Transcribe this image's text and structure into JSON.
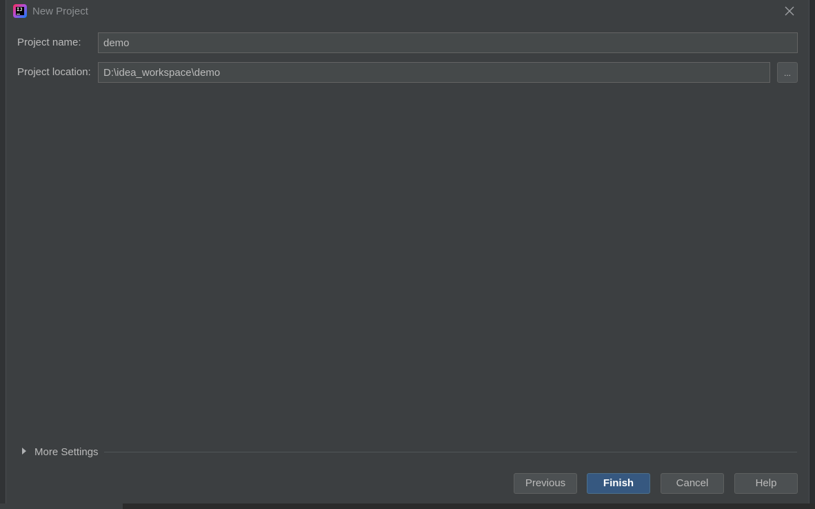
{
  "window": {
    "title": "New Project",
    "app_icon": "intellij-idea-icon",
    "close_icon": "close-icon"
  },
  "form": {
    "project_name": {
      "label": "Project name:",
      "value": "demo"
    },
    "project_location": {
      "label": "Project location:",
      "value": "D:\\idea_workspace\\demo",
      "browse_label": "..."
    }
  },
  "more_settings": {
    "label": "More Settings",
    "expanded": false
  },
  "buttons": {
    "previous": "Previous",
    "finish": "Finish",
    "cancel": "Cancel",
    "help": "Help"
  },
  "colors": {
    "background": "#3c3f41",
    "input_background": "#45494a",
    "primary_button": "#365880",
    "text": "#bbbbbb"
  }
}
